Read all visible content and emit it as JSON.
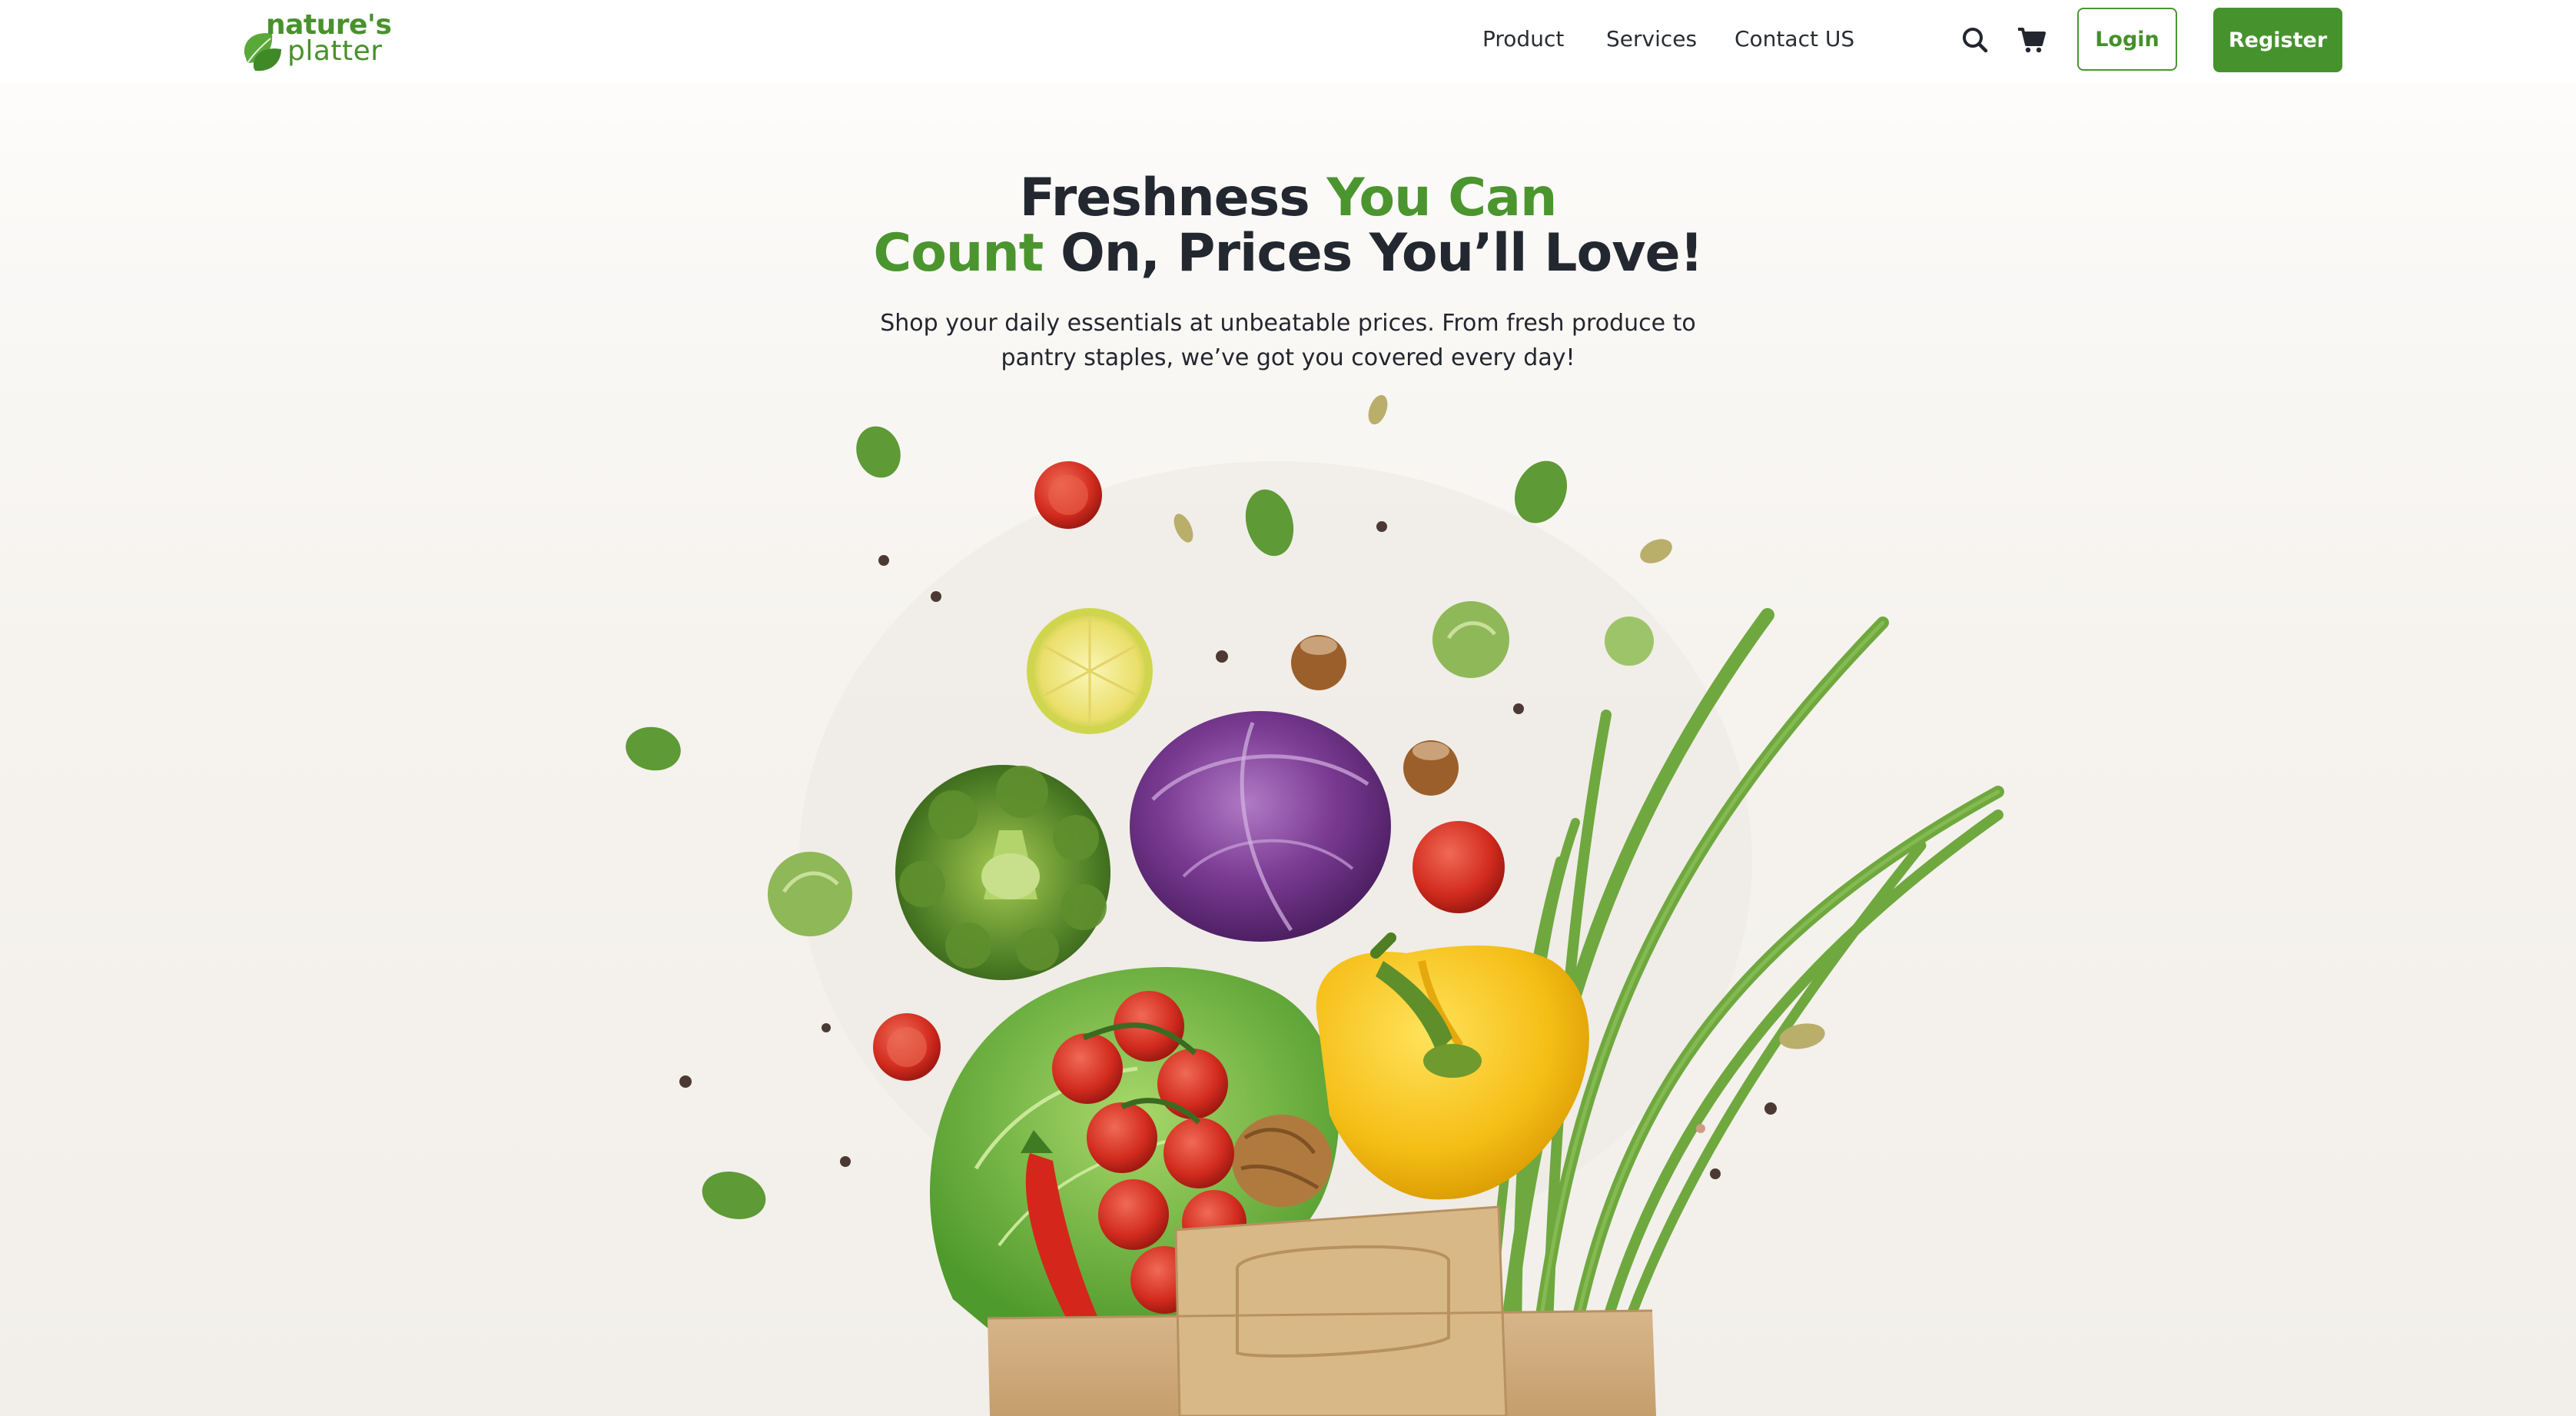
{
  "brand": {
    "line1": "nature's",
    "line2": "platter",
    "color": "#48912c"
  },
  "nav": {
    "links": [
      "Product",
      "Services",
      "Contact US"
    ],
    "search_icon": "search-icon",
    "cart_icon": "cart-icon",
    "login_label": "Login",
    "register_label": "Register"
  },
  "hero": {
    "title_part1": "Freshness ",
    "title_highlight1": "You Can",
    "title_highlight2": "Count",
    "title_part2": " On, Prices You’ll Love!",
    "subtitle_line1": "Shop your daily essentials at unbeatable prices. From fresh produce to",
    "subtitle_line2": "pantry staples, we’ve got you covered every day!",
    "image": "grocery-bag-vegetables-illustration"
  },
  "colors": {
    "accent": "#46932d",
    "text": "#232830"
  }
}
